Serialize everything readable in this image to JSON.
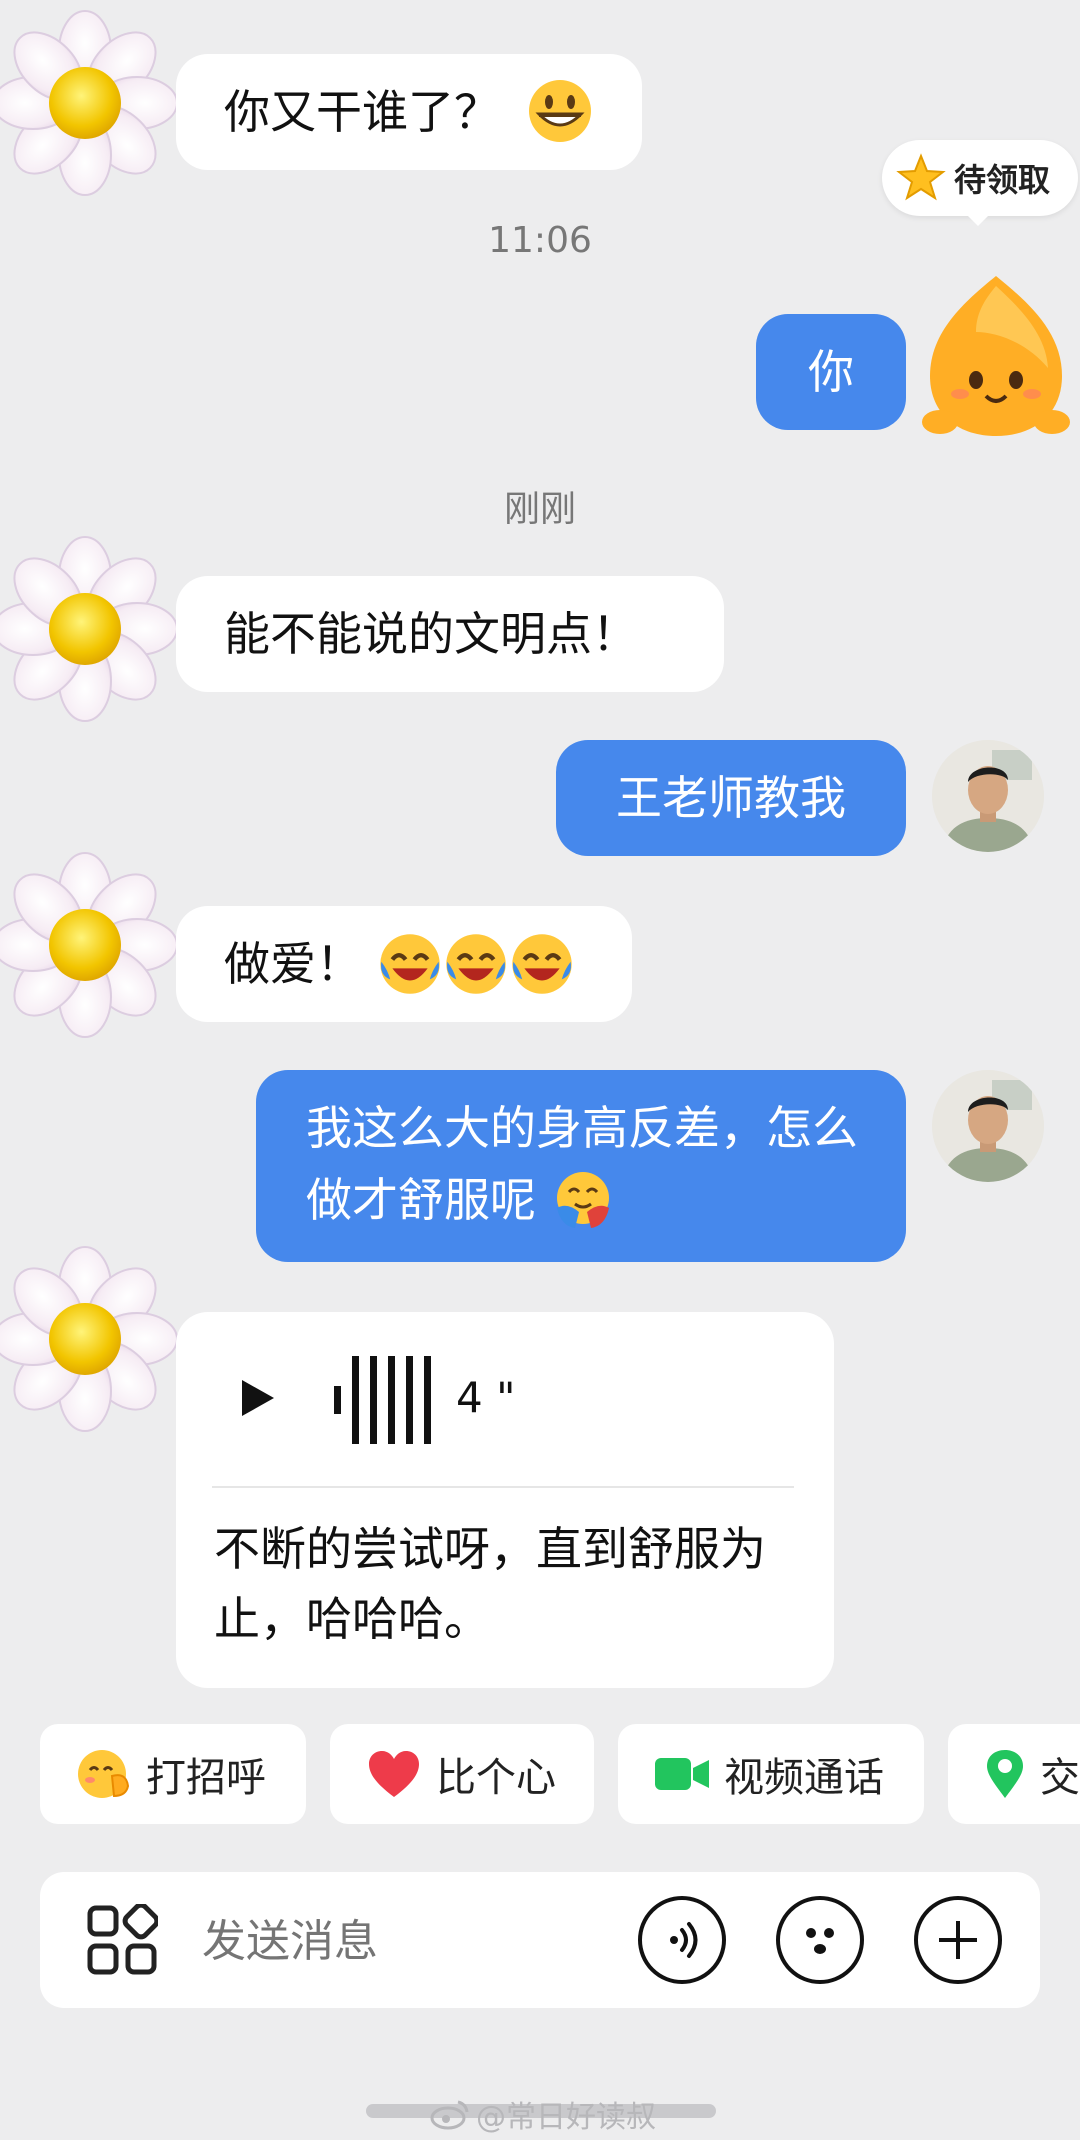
{
  "messages": [
    {
      "side": "in",
      "text": "你又干谁了？",
      "emoji": "grinning-face"
    },
    {
      "side": "out",
      "text": "你"
    },
    {
      "side": "in",
      "text": "能不能说的文明点！"
    },
    {
      "side": "out",
      "text": "王老师教我"
    },
    {
      "side": "in",
      "text": "做爱！",
      "emoji": "laughing-crying-face x3"
    },
    {
      "side": "out",
      "text": "我这么大的身高反差，怎么做才舒服呢",
      "emoji": "hugging-face"
    },
    {
      "side": "in",
      "voice_duration": "4 \"",
      "transcript": "不断的尝试呀，直到舒服为止，哈哈哈。"
    }
  ],
  "timestamps": [
    "11:06",
    "刚刚"
  ],
  "reward_badge": {
    "label": "待领取"
  },
  "quick_actions": [
    "打招呼",
    "比个心",
    "视频通话",
    "交"
  ],
  "input": {
    "placeholder": "发送消息"
  },
  "watermark": "@常日好读叔",
  "colors": {
    "bubble_out": "#4688ec",
    "bubble_in": "#ffffff",
    "background": "#ededee"
  }
}
